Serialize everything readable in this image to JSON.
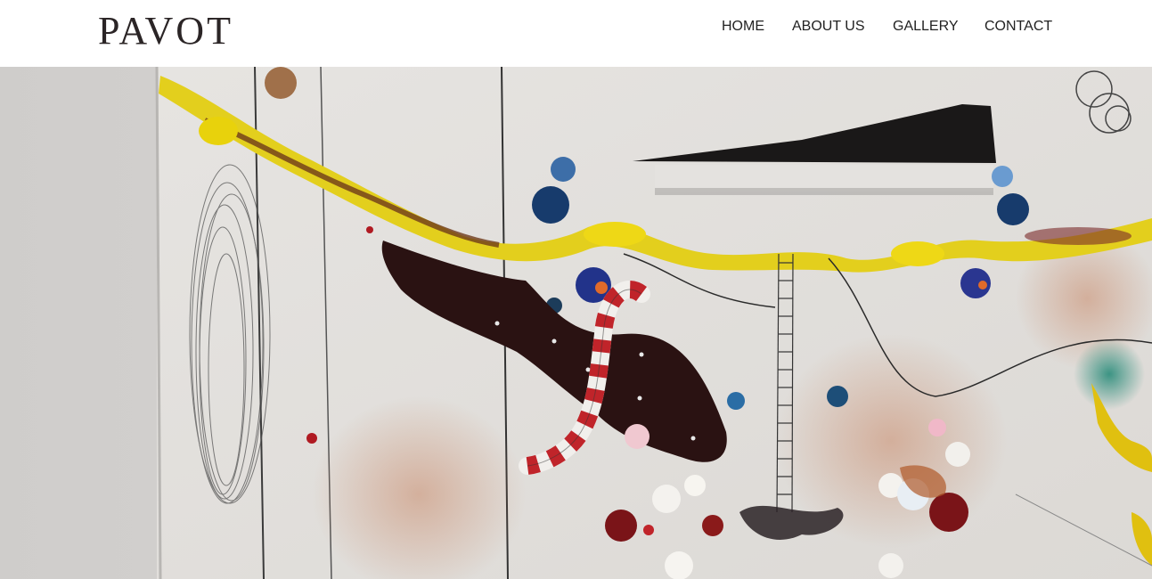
{
  "site": {
    "logo": "PAVOT"
  },
  "nav": {
    "items": [
      {
        "label": "HOME"
      },
      {
        "label": "ABOUT US"
      },
      {
        "label": "GALLERY"
      },
      {
        "label": "CONTACT"
      }
    ]
  },
  "hero": {
    "image": "abstract-painting-artwork",
    "palette": {
      "wall": "#d8d6d4",
      "canvas": "#e3e1de",
      "yellow": "#e8d21a",
      "dark": "#241413",
      "red": "#c0242a",
      "blue": "#1d3f7a"
    }
  }
}
